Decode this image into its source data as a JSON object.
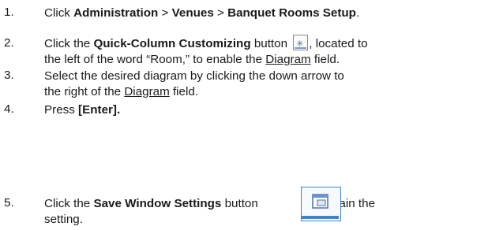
{
  "steps": [
    {
      "number": "1.",
      "lines": [
        {
          "pre": "Click ",
          "b1": "Administration",
          "mid1": " > ",
          "b2": "Venues",
          "mid2": " > ",
          "b3": "Banquet Rooms Setup",
          "post": "."
        }
      ]
    },
    {
      "number": "2.",
      "line1": {
        "pre": "Click the ",
        "bold": "Quick-Column Customizing",
        "mid": " button ",
        "post": ", located to"
      },
      "line2": {
        "pre": "the left of the word “Room,” to enable the ",
        "link": "Diagram",
        "post": " field."
      },
      "icon": "quick-column-customizing-icon"
    },
    {
      "number": "3.",
      "line1": "Select the desired diagram by clicking the down arrow to",
      "line2": {
        "pre": "the right of the ",
        "link": "Diagram",
        "post": " field."
      }
    },
    {
      "number": "4.",
      "pre": "Press ",
      "bold": "[Enter]."
    },
    {
      "number": "5.",
      "line1": {
        "pre": "Click the ",
        "bold": "Save Window Settings",
        "mid": " button",
        "post": "to retain the"
      },
      "line2": "setting.",
      "icon": "save-window-settings-icon"
    }
  ],
  "colors": {
    "text": "#1a1a1a",
    "icon_border": "#3c86d0",
    "icon_accent": "#4a66a8"
  }
}
